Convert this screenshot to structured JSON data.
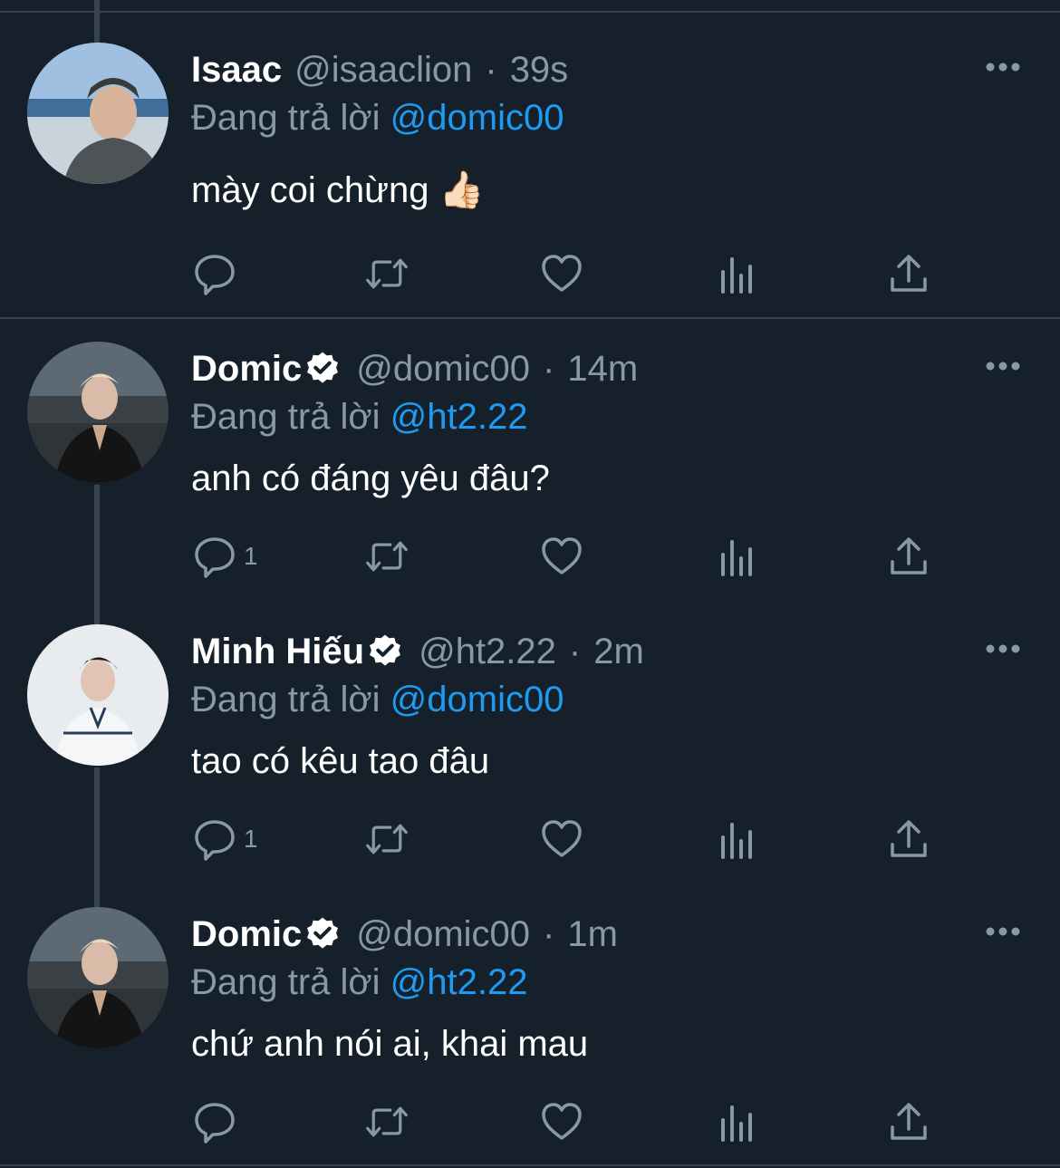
{
  "reply_prefix": "Đang trả lời",
  "colors": {
    "background": "#15202b",
    "secondary_text": "#8899a6",
    "mention": "#1d9bf0",
    "divider": "#38444d"
  },
  "tweets": [
    {
      "name": "Isaac",
      "handle": "@isaaclion",
      "dot": "·",
      "time": "39s",
      "reply_to": "@domic00",
      "text": "mày coi chừng 👍🏻",
      "reply_count": ""
    },
    {
      "name": "Domic",
      "handle": "@domic00",
      "dot": "·",
      "time": "14m",
      "reply_to": "@ht2.22",
      "text": "anh có đáng yêu đâu?",
      "reply_count": "1"
    },
    {
      "name": "Minh Hiếu",
      "handle": "@ht2.22",
      "dot": "·",
      "time": "2m",
      "reply_to": "@domic00",
      "text": "tao có kêu tao đâu",
      "reply_count": "1"
    },
    {
      "name": "Domic",
      "handle": "@domic00",
      "dot": "·",
      "time": "1m",
      "reply_to": "@ht2.22",
      "text": "chứ anh nói ai, khai mau",
      "reply_count": ""
    }
  ],
  "icons": [
    "reply-icon",
    "retweet-icon",
    "like-icon",
    "analytics-icon",
    "share-icon",
    "more-icon",
    "verified-badge-icon"
  ]
}
